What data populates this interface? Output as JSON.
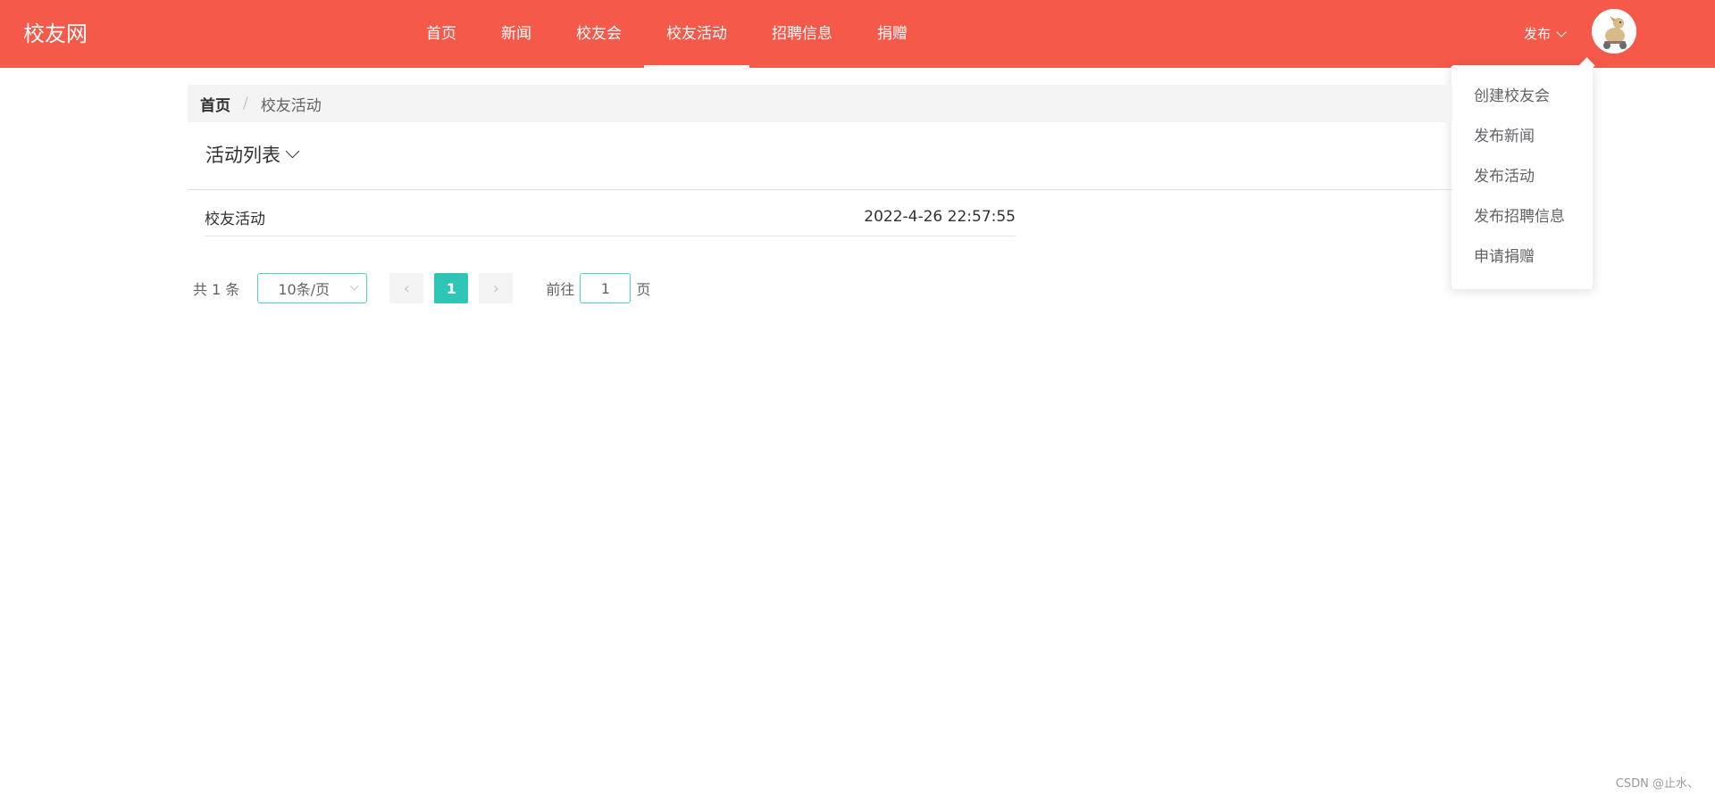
{
  "header": {
    "brand": "校友网",
    "nav": [
      {
        "label": "首页",
        "active": false
      },
      {
        "label": "新闻",
        "active": false
      },
      {
        "label": "校友会",
        "active": false
      },
      {
        "label": "校友活动",
        "active": true
      },
      {
        "label": "招聘信息",
        "active": false
      },
      {
        "label": "捐赠",
        "active": false
      }
    ],
    "publish_label": "发布",
    "avatar_icon": "user-avatar-icon"
  },
  "dropdown": {
    "items": [
      "创建校友会",
      "发布新闻",
      "发布活动",
      "发布招聘信息",
      "申请捐赠"
    ]
  },
  "breadcrumb": {
    "home": "首页",
    "separator": "/",
    "current": "校友活动"
  },
  "section": {
    "title": "活动列表"
  },
  "list": [
    {
      "title": "校友活动",
      "time": "2022-4-26 22:57:55"
    }
  ],
  "pagination": {
    "total_text": "共 1 条",
    "page_size": "10条/页",
    "current_page": "1",
    "goto_prefix": "前往",
    "goto_value": "1",
    "goto_suffix": "页"
  },
  "watermark": "CSDN @止水、",
  "colors": {
    "header_bg": "#f4594a",
    "accent": "#2ec4b6"
  }
}
